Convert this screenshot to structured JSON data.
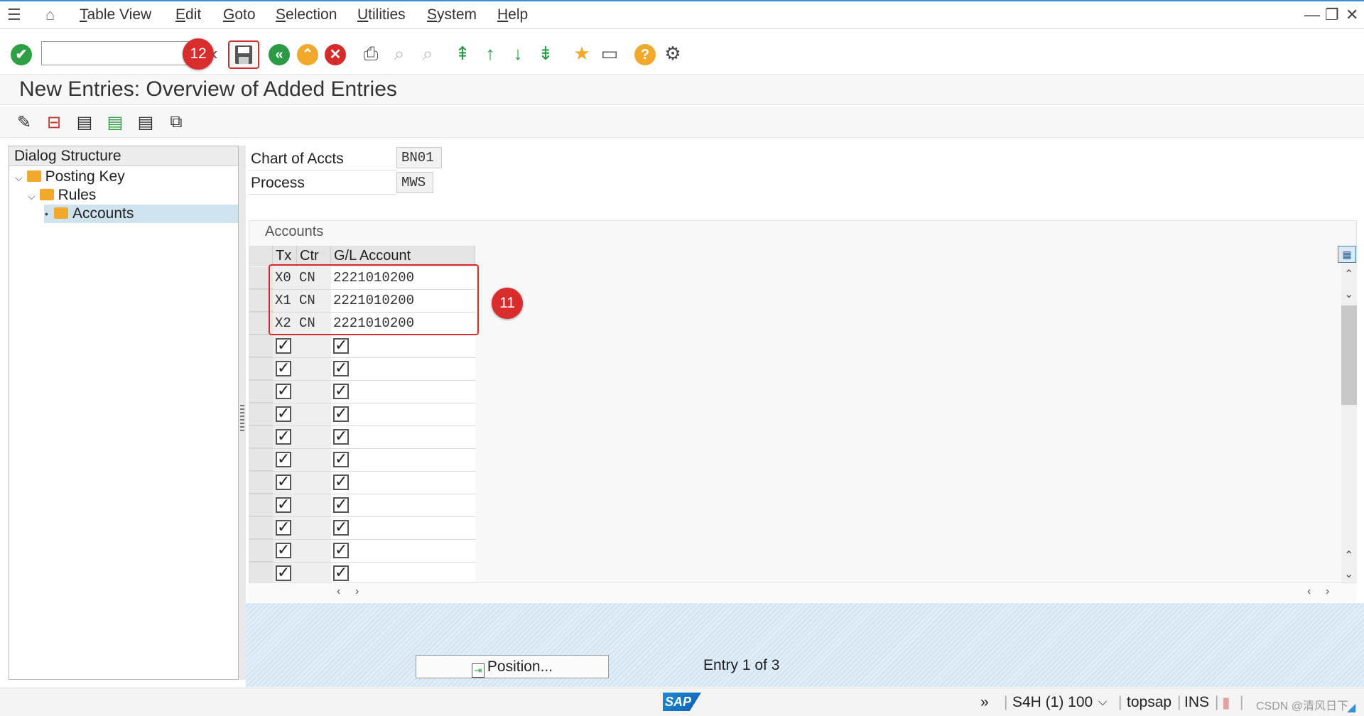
{
  "menu": {
    "items": [
      "Table View",
      "Edit",
      "Goto",
      "Selection",
      "Utilities",
      "System",
      "Help"
    ]
  },
  "window_controls": [
    "—",
    "❐",
    "✕"
  ],
  "toolbar": {
    "command_field_value": "",
    "badge_12": "12",
    "badge_11": "11"
  },
  "page": {
    "title": "New Entries: Overview of Added Entries"
  },
  "dialog_structure": {
    "header": "Dialog Structure",
    "items": [
      {
        "label": "Posting Key",
        "level": 0
      },
      {
        "label": "Rules",
        "level": 1
      },
      {
        "label": "Accounts",
        "level": 2,
        "selected": true
      }
    ]
  },
  "header_fields": {
    "chart_of_accts_label": "Chart of Accts",
    "chart_of_accts_value": "BN01",
    "process_label": "Process",
    "process_value": "MWS"
  },
  "table": {
    "title": "Accounts",
    "columns": [
      "Tx",
      "Ctr",
      "G/L Account"
    ],
    "rows": [
      {
        "tx": "X0",
        "ctr": "CN",
        "gl": "2221010200"
      },
      {
        "tx": "X1",
        "ctr": "CN",
        "gl": "2221010200"
      },
      {
        "tx": "X2",
        "ctr": "CN",
        "gl": "2221010200"
      }
    ],
    "empty_rows": 11
  },
  "footer": {
    "position_button": "Position...",
    "entry_info": "Entry 1 of 3"
  },
  "status_bar": {
    "logo": "SAP",
    "system": "S4H (1) 100",
    "server": "topsap",
    "mode": "INS",
    "watermark": "CSDN @清风日下"
  },
  "colors": {
    "accent_blue": "#3a8fd6",
    "annotation_red": "#d62b2b",
    "folder_yellow": "#f0a92c"
  }
}
